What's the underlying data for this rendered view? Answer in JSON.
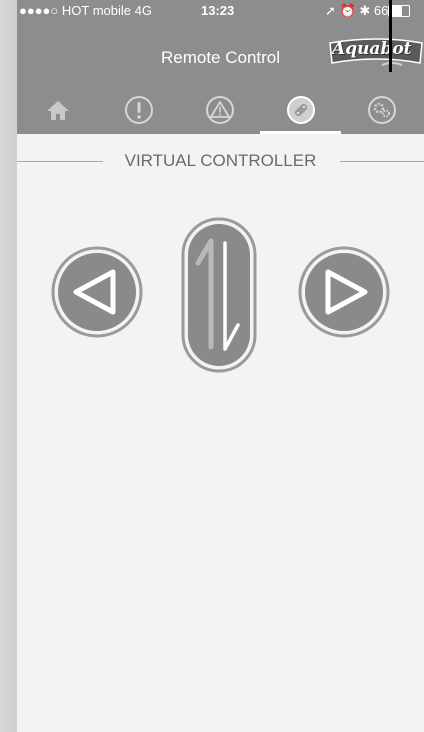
{
  "status_bar": {
    "carrier": "●●●●○ HOT mobile  4G",
    "time": "13:23",
    "battery_percent": "66%",
    "battery_level": 0.66
  },
  "nav": {
    "title": "Remote Control",
    "logo_text": "Aquabot"
  },
  "tabs": [
    {
      "icon": "home-icon",
      "active": false
    },
    {
      "icon": "alert-circle-icon",
      "active": false
    },
    {
      "icon": "warning-triangle-icon",
      "active": false
    },
    {
      "icon": "remote-icon",
      "active": true
    },
    {
      "icon": "gears-icon",
      "active": false
    }
  ],
  "section": {
    "title": "VIRTUAL CONTROLLER"
  },
  "controls": {
    "left": {
      "icon": "left-arrow-icon"
    },
    "center": {
      "icon": "up-down-arrows-icon"
    },
    "right": {
      "icon": "right-arrow-icon"
    }
  },
  "colors": {
    "header_bg": "#8d8d8d",
    "page_bg": "#f3f3f3",
    "button_fill": "#8a8a8a",
    "button_ring": "#9a9a9a"
  }
}
